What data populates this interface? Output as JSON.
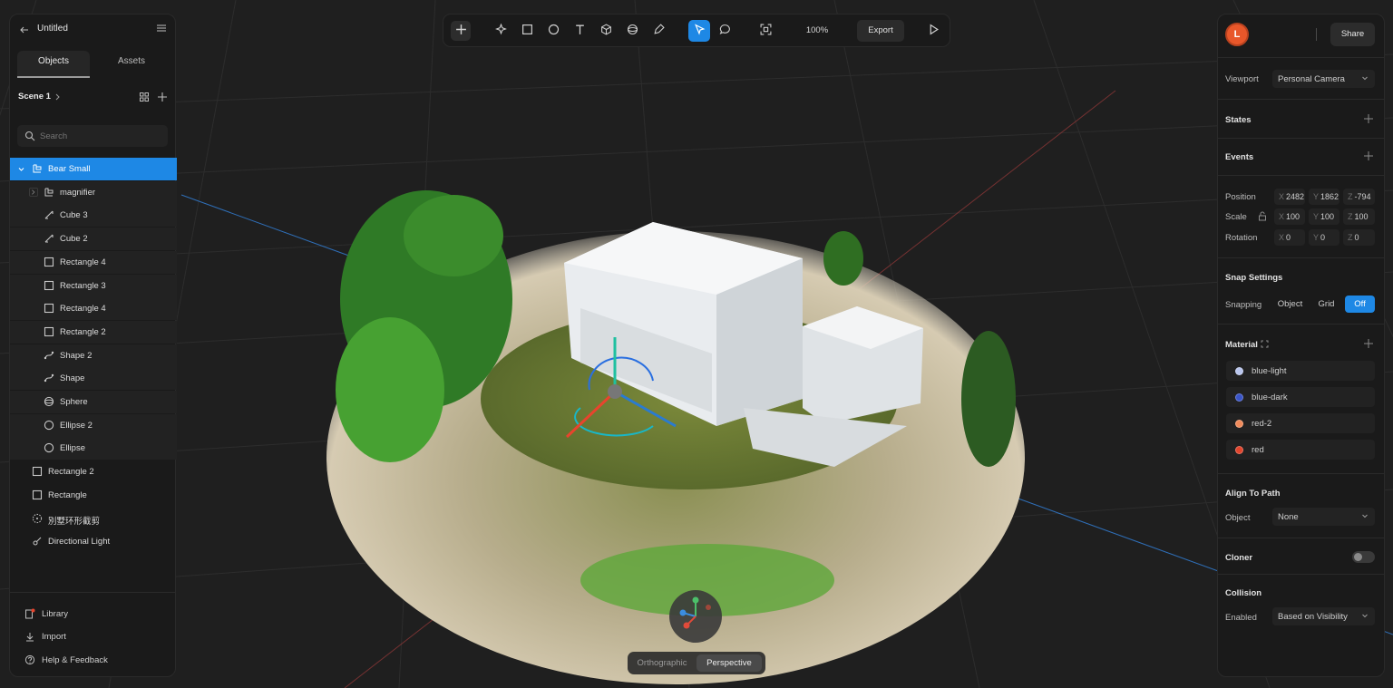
{
  "colors": {
    "accent": "#1e88e5",
    "panel": "#1a1a1a",
    "avatar": "#e8572a"
  },
  "left_panel": {
    "title": "Untitled",
    "tabs": [
      "Objects",
      "Assets"
    ],
    "scene": "Scene 1",
    "search_placeholder": "Search",
    "tree": [
      {
        "label": "Bear Small",
        "icon": "group-icon",
        "selected": true,
        "level": 0,
        "expanded": true
      },
      {
        "label": "magnifier",
        "icon": "group-icon",
        "level": 1,
        "collapsed_child": true
      },
      {
        "label": "Cube 3",
        "icon": "path-icon",
        "level": 1
      },
      {
        "label": "Cube 2",
        "icon": "path-icon",
        "level": 1
      },
      {
        "label": "Rectangle 4",
        "icon": "rectangle-icon",
        "level": 1
      },
      {
        "label": "Rectangle 3",
        "icon": "rectangle-icon",
        "level": 1
      },
      {
        "label": "Rectangle 4",
        "icon": "rectangle-icon",
        "level": 1
      },
      {
        "label": "Rectangle 2",
        "icon": "rectangle-icon",
        "level": 1
      },
      {
        "label": "Shape 2",
        "icon": "shape-icon",
        "level": 1
      },
      {
        "label": "Shape",
        "icon": "shape-icon",
        "level": 1
      },
      {
        "label": "Sphere",
        "icon": "sphere-icon",
        "level": 1
      },
      {
        "label": "Ellipse 2",
        "icon": "ellipse-icon",
        "level": 1
      },
      {
        "label": "Ellipse",
        "icon": "ellipse-icon",
        "level": 1
      },
      {
        "label": "Rectangle 2",
        "icon": "rectangle-icon",
        "level": 0
      },
      {
        "label": "Rectangle",
        "icon": "rectangle-icon",
        "level": 0
      },
      {
        "label": "別墅环形截剪",
        "icon": "gaussian-splat-icon",
        "level": 0
      },
      {
        "label": "Directional Light",
        "icon": "light-icon",
        "level": 0
      }
    ],
    "footer": [
      {
        "label": "Library",
        "icon": "library-icon"
      },
      {
        "label": "Import",
        "icon": "import-icon"
      },
      {
        "label": "Help & Feedback",
        "icon": "help-icon"
      }
    ]
  },
  "toolbar": {
    "zoom": "100%",
    "export": "Export"
  },
  "viewport": {
    "camera_modes": [
      "Orthographic",
      "Perspective"
    ],
    "active_mode": "Perspective"
  },
  "right_panel": {
    "avatar": "L",
    "share": "Share",
    "viewport_label": "Viewport",
    "viewport_value": "Personal Camera",
    "states": "States",
    "events": "Events",
    "position": {
      "label": "Position",
      "x": "2482",
      "y": "1862",
      "z": "-794"
    },
    "scale": {
      "label": "Scale",
      "x": "100",
      "y": "100",
      "z": "100"
    },
    "rotation": {
      "label": "Rotation",
      "x": "0",
      "y": "0",
      "z": "0"
    },
    "axis": {
      "x": "X",
      "y": "Y",
      "z": "Z"
    },
    "snap": {
      "title": "Snap Settings",
      "label": "Snapping",
      "options": [
        "Object",
        "Grid",
        "Off"
      ],
      "active": "Off"
    },
    "material": {
      "title": "Material",
      "items": [
        {
          "name": "blue-light",
          "color": "#b9c6ee"
        },
        {
          "name": "blue-dark",
          "color": "#3a55c8"
        },
        {
          "name": "red-2",
          "color": "#f08a5a"
        },
        {
          "name": "red",
          "color": "#e2452d"
        }
      ]
    },
    "align": {
      "title": "Align To Path",
      "label": "Object",
      "value": "None"
    },
    "cloner": {
      "title": "Cloner",
      "enabled": false
    },
    "collision": {
      "title": "Collision",
      "label": "Enabled",
      "value": "Based on Visibility"
    }
  }
}
